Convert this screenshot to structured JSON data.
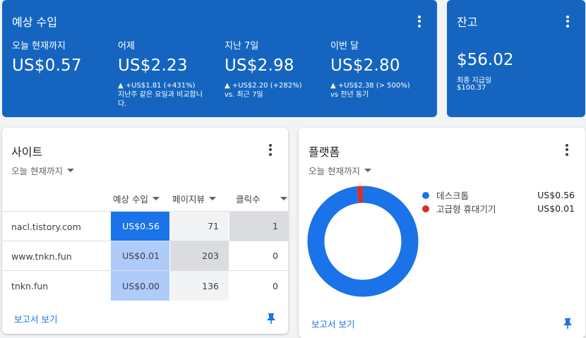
{
  "estimated_earnings": {
    "title": "예상 수입",
    "metrics": [
      {
        "label": "오늘 현재까지",
        "value": "US$0.57",
        "delta": "",
        "note": ""
      },
      {
        "label": "어제",
        "value": "US$2.23",
        "delta": "▲ +US$1.81 (+431%)",
        "note": "지난주 같은 요일과 비교합니다."
      },
      {
        "label": "지난 7일",
        "value": "US$2.98",
        "delta": "▲ +US$2.20 (+282%)",
        "note": "vs. 최근 7일"
      },
      {
        "label": "이번 달",
        "value": "US$2.80",
        "delta": "▲ +US$2.38 (> 500%)",
        "note": "vs 전년 동기"
      }
    ]
  },
  "balance": {
    "title": "잔고",
    "value": "$56.02",
    "last_payment_label": "최종 지급일",
    "last_payment_value": "$100.37"
  },
  "sites": {
    "title": "사이트",
    "period": "오늘 현재까지",
    "columns": [
      "예상 수입",
      "페이지뷰",
      "클릭수"
    ],
    "rows": [
      {
        "site": "nacl.tistory.com",
        "earnings": "US$0.56",
        "pageviews": "71",
        "clicks": "1"
      },
      {
        "site": "www.tnkn.fun",
        "earnings": "US$0.01",
        "pageviews": "203",
        "clicks": "0"
      },
      {
        "site": "tnkn.fun",
        "earnings": "US$0.00",
        "pageviews": "136",
        "clicks": "0"
      }
    ],
    "report_link": "보고서 보기"
  },
  "platforms": {
    "title": "플랫폼",
    "period": "오늘 현재까지",
    "report_link": "보고서 보기",
    "legend": [
      {
        "label": "데스크톱",
        "value": "US$0.56",
        "color": "#1a73e8"
      },
      {
        "label": "고급형 휴대기기",
        "value": "US$0.01",
        "color": "#d93025"
      }
    ]
  },
  "chart_data": {
    "type": "pie",
    "categories": [
      "데스크톱",
      "고급형 휴대기기"
    ],
    "values": [
      0.56,
      0.01
    ],
    "colors": [
      "#1a73e8",
      "#d93025"
    ]
  },
  "icons": {
    "menu": "more-vert-icon",
    "pin": "pin-icon",
    "dropdown": "caret-down-icon"
  }
}
